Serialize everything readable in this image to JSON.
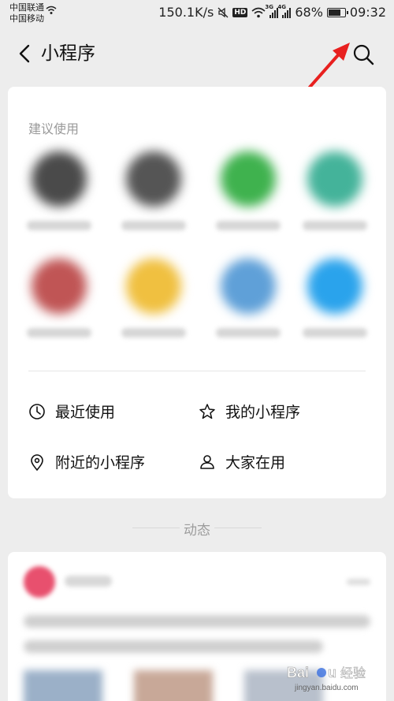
{
  "status_bar": {
    "carrier1": "中国联通",
    "carrier2": "中国移动",
    "speed": "150.1K/s",
    "hd": "HD",
    "net1": "3G",
    "net2": "4G",
    "battery": "68%",
    "battery_level": 0.68,
    "time": "09:32"
  },
  "header": {
    "title": "小程序",
    "back_icon": "chevron-left-icon",
    "search_icon": "search-icon"
  },
  "annotation": {
    "color": "#e8201f"
  },
  "suggested": {
    "label": "建议使用",
    "apps": [
      {
        "color": "#4a4a4a"
      },
      {
        "color": "#555555"
      },
      {
        "color": "#3fb24e"
      },
      {
        "color": "#44b39a"
      },
      {
        "color": "#c05555"
      },
      {
        "color": "#f0c040"
      },
      {
        "color": "#5fa0d8"
      },
      {
        "color": "#2aa3ec"
      }
    ]
  },
  "menu": {
    "recent": "最近使用",
    "my_programs": "我的小程序",
    "nearby": "附近的小程序",
    "popular": "大家在用"
  },
  "dynamics": {
    "label": "动态"
  },
  "watermark": "Baidu 经验\njingyan.baidu.com"
}
